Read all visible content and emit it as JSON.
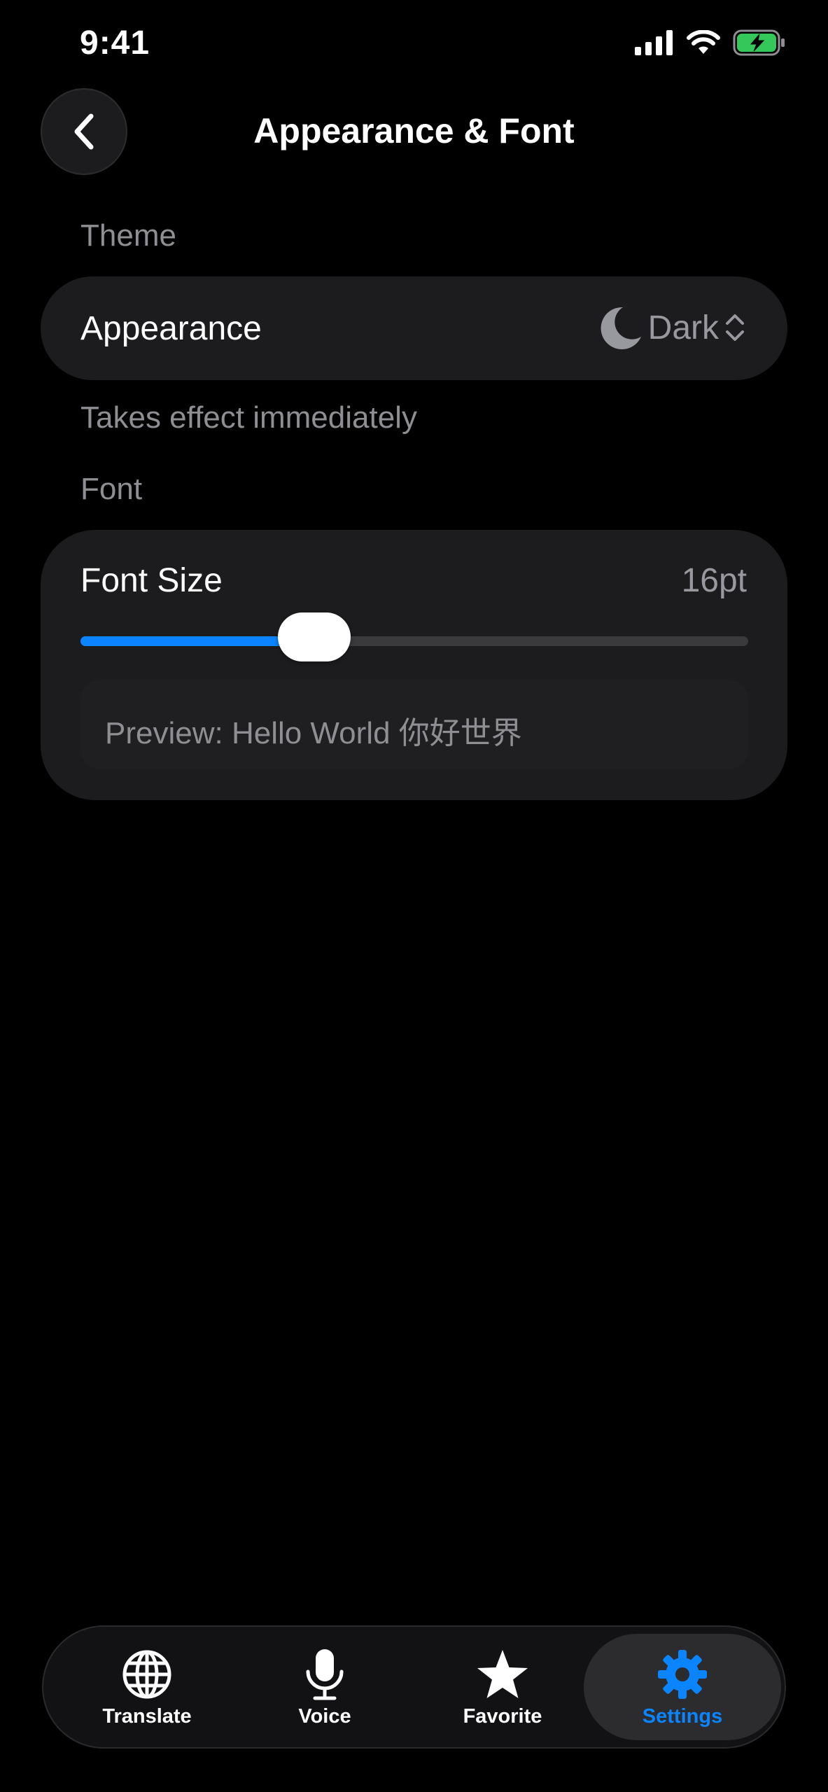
{
  "status_bar": {
    "time": "9:41"
  },
  "nav": {
    "title": "Appearance & Font"
  },
  "theme_section": {
    "label": "Theme",
    "appearance": {
      "label": "Appearance",
      "value": "Dark",
      "icon": "moon-icon"
    },
    "note": "Takes effect immediately"
  },
  "font_section": {
    "label": "Font",
    "font_size": {
      "label": "Font Size",
      "value": "16pt",
      "slider_fraction": 0.35
    },
    "preview": "Preview: Hello World 你好世界"
  },
  "tab_bar": {
    "tabs": [
      {
        "label": "Translate",
        "icon": "globe-icon"
      },
      {
        "label": "Voice",
        "icon": "microphone-icon"
      },
      {
        "label": "Favorite",
        "icon": "star-icon"
      },
      {
        "label": "Settings",
        "icon": "gear-icon",
        "active": true
      }
    ]
  },
  "colors": {
    "accent": "#0a84ff",
    "card": "#1c1c1e",
    "secondary_text": "#8e8e93"
  }
}
